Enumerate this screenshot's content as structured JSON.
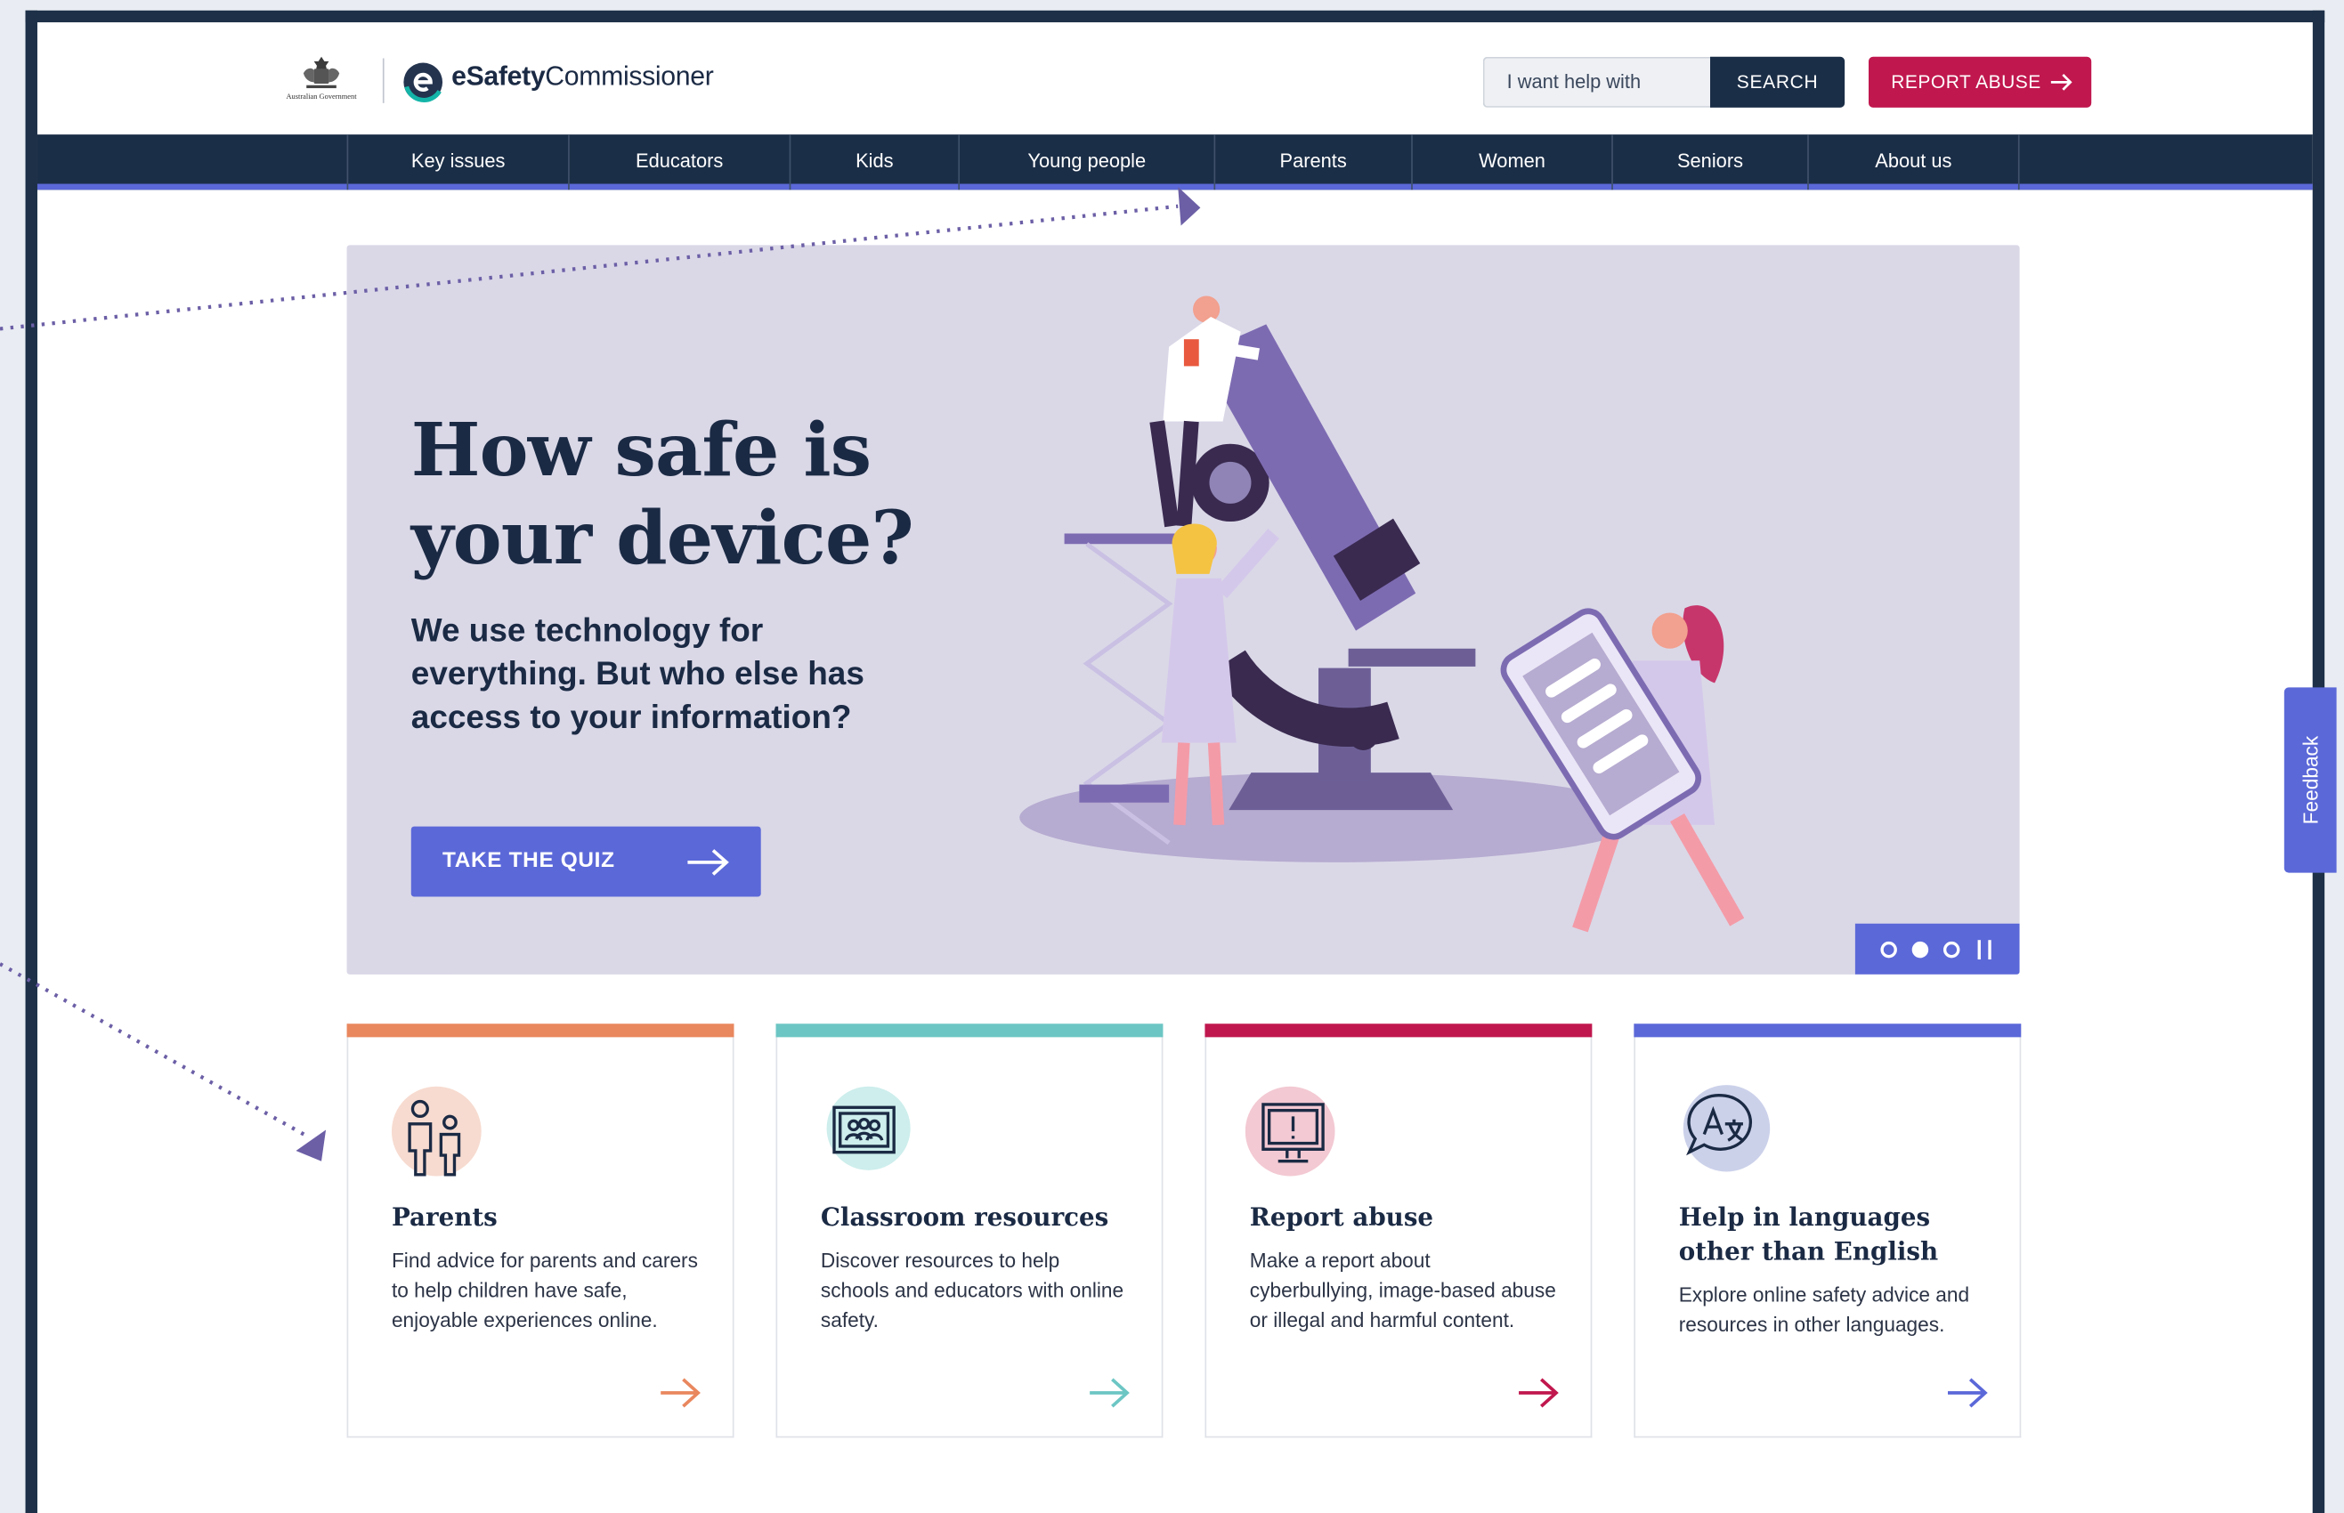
{
  "header": {
    "gov_label": "Australian Government",
    "brand_bold": "eSafety",
    "brand_regular": "Commissioner",
    "search_placeholder": "I want help with",
    "search_button": "SEARCH",
    "report_button": "REPORT ABUSE"
  },
  "nav": {
    "items": [
      "Key issues",
      "Educators",
      "Kids",
      "Young people",
      "Parents",
      "Women",
      "Seniors",
      "About us"
    ]
  },
  "hero": {
    "title": "How safe is your device?",
    "subtitle": "We use technology for everything. But who else has access to your information?",
    "cta": "TAKE THE QUIZ",
    "carousel": {
      "slides": 3,
      "active_slide": 2,
      "state": "playing (pause control shown)"
    }
  },
  "cards": [
    {
      "title": "Parents",
      "text": "Find advice for parents and carers to help children have safe, enjoyable experiences online.",
      "icon": "parents-icon",
      "color": "#e9875e"
    },
    {
      "title": "Classroom resources",
      "text": "Discover resources to help schools and educators with online safety.",
      "icon": "classroom-icon",
      "color": "#6cc6c4"
    },
    {
      "title": "Report abuse",
      "text": "Make a report about cyberbullying, image-based abuse or illegal and harmful content.",
      "icon": "report-monitor-icon",
      "color": "#c0174e"
    },
    {
      "title": "Help in languages other than English",
      "text": "Explore online safety advice and resources in other languages.",
      "icon": "translate-icon",
      "color": "#5b68d8"
    }
  ],
  "feedback": {
    "label": "Feedback"
  },
  "colors": {
    "navy": "#1b2e47",
    "accent": "#5b68d8",
    "report": "#c0174e",
    "hero_bg": "#dad8e7"
  }
}
